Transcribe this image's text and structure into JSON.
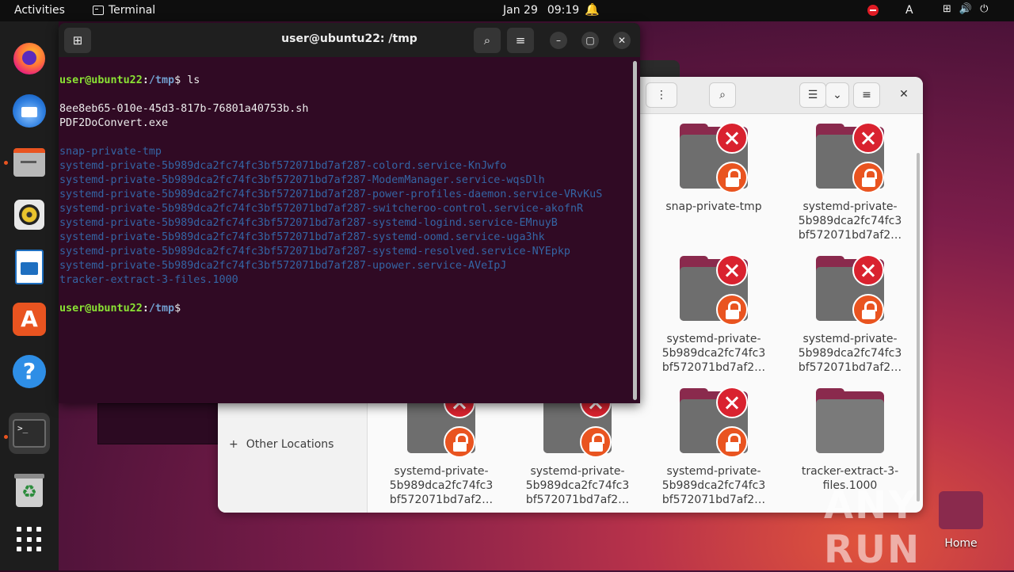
{
  "topbar": {
    "activities": "Activities",
    "app_name": "Terminal",
    "date": "Jan 29",
    "time": "09:19",
    "keyboard_layout": "A"
  },
  "terminal": {
    "title": "user@ubuntu22: /tmp",
    "prompt_user": "user@ubuntu22",
    "prompt_path": "/tmp",
    "command": "ls",
    "output_plain": [
      "8ee8eb65-010e-45d3-817b-76801a40753b.sh",
      "PDF2DoConvert.exe"
    ],
    "output_dirs": [
      "snap-private-tmp",
      "systemd-private-5b989dca2fc74fc3bf572071bd7af287-colord.service-KnJwfo",
      "systemd-private-5b989dca2fc74fc3bf572071bd7af287-ModemManager.service-wqsDlh",
      "systemd-private-5b989dca2fc74fc3bf572071bd7af287-power-profiles-daemon.service-VRvKuS",
      "systemd-private-5b989dca2fc74fc3bf572071bd7af287-switcheroo-control.service-akofnR",
      "systemd-private-5b989dca2fc74fc3bf572071bd7af287-systemd-logind.service-EMnuyB",
      "systemd-private-5b989dca2fc74fc3bf572071bd7af287-systemd-oomd.service-uga3hk",
      "systemd-private-5b989dca2fc74fc3bf572071bd7af287-systemd-resolved.service-NYEpkp",
      "systemd-private-5b989dca2fc74fc3bf572071bd7af287-upower.service-AVeIpJ",
      "tracker-extract-3-files.1000"
    ]
  },
  "files": {
    "sidebar_other_locations": "Other Locations",
    "items": [
      {
        "name": "snap-private-tmp",
        "locked": true
      },
      {
        "name": "systemd-private-\n5b989dca2fc74fc3\nbf572071bd7af2…",
        "locked": true
      },
      {
        "name": "systemd-private-\n5b989dca2fc74fc3\nbf572071bd7af2…",
        "locked": true
      },
      {
        "name": "systemd-private-\n5b989dca2fc74fc3\nbf572071bd7af2…",
        "locked": true
      },
      {
        "name": "systemd-private-\n5b989dca2fc74fc3\nbf572071bd7af2…",
        "locked": true
      },
      {
        "name": "systemd-private-\n5b989dca2fc74fc3\nbf572071bd7af2…",
        "locked": true
      },
      {
        "name": "systemd-private-\n5b989dca2fc74fc3\nbf572071bd7af2…",
        "locked": true
      },
      {
        "name": "tracker-extract-3-\nfiles.1000",
        "locked": false
      }
    ]
  },
  "desktop": {
    "home_label": "Home",
    "watermark": "ANY RUN"
  },
  "colors": {
    "terminal_bg": "#300a24",
    "prompt_green": "#8ae234",
    "dir_blue": "#3465a4",
    "ubuntu_orange": "#e95420"
  }
}
